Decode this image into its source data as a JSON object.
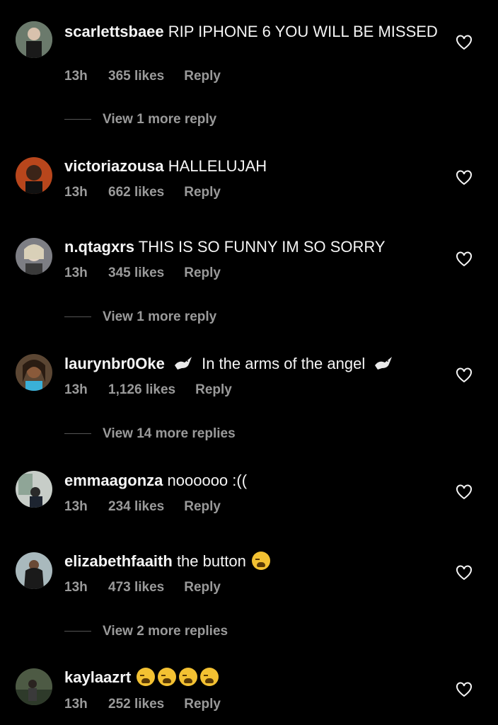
{
  "comments": [
    {
      "user": "scarlettsbaee",
      "text": "RIP IPHONE 6 YOU WILL BE MISSED",
      "time": "13h",
      "likes": "365 likes",
      "reply": "Reply",
      "view_more": "View 1 more reply",
      "avatar_color": "#5a6a5e"
    },
    {
      "user": "victoriazousa",
      "text": "HALLELUJAH",
      "time": "13h",
      "likes": "662 likes",
      "reply": "Reply",
      "view_more": "",
      "avatar_color": "#b8461c"
    },
    {
      "user": "n.qtagxrs",
      "text": "THIS IS SO FUNNY IM SO SORRY",
      "time": "13h",
      "likes": "345 likes",
      "reply": "Reply",
      "view_more": "View 1 more reply",
      "avatar_color": "#7d7e84"
    },
    {
      "user": "laurynbr0Oke",
      "text": "In the arms of the angel",
      "time": "13h",
      "likes": "1,126 likes",
      "reply": "Reply",
      "view_more": "View 14 more replies",
      "avatar_color": "#5b4633"
    },
    {
      "user": "emmaagonza",
      "text": "noooooo :((",
      "time": "13h",
      "likes": "234 likes",
      "reply": "Reply",
      "view_more": "",
      "avatar_color": "#a7b0aa"
    },
    {
      "user": "elizabethfaaith",
      "text": "the button",
      "time": "13h",
      "likes": "473 likes",
      "reply": "Reply",
      "view_more": "View 2 more replies",
      "avatar_color": "#8b9a9d"
    },
    {
      "user": "kaylaazrt",
      "text": "",
      "time": "13h",
      "likes": "252 likes",
      "reply": "Reply",
      "view_more": "",
      "avatar_color": "#4d5a44"
    }
  ],
  "icons": {
    "like": "heart-outline-icon",
    "emoji_cry": "loudly-crying-face-emoji",
    "emoji_dove": "dove-emoji"
  },
  "colors": {
    "background": "#000000",
    "text": "#f5f5f5",
    "secondary": "#9a9a9a"
  }
}
